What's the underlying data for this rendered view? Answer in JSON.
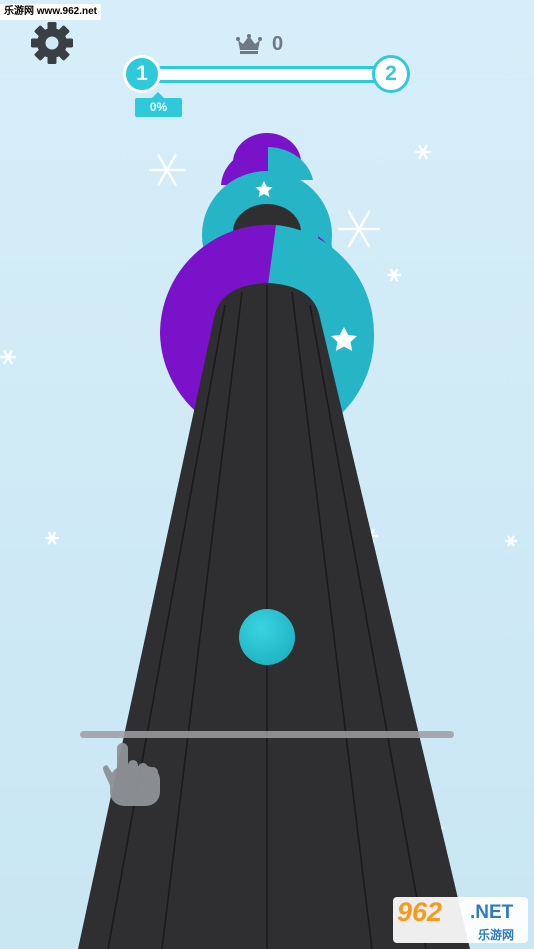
{
  "header": {
    "watermark_top": "乐游网 www.962.net",
    "score": "0",
    "level_current": "1",
    "level_next": "2",
    "progress_label": "0%",
    "progress_fraction": 0
  },
  "icons": {
    "settings": "gear-icon",
    "crown": "crown-icon",
    "hand": "swipe-hand-icon"
  },
  "colors": {
    "background": "#cfe9f6",
    "accent": "#2fc9dc",
    "purple": "#7a12c9",
    "teal": "#26b5c6",
    "track": "#2f2f31",
    "ball": "#26c3d3"
  },
  "logo": {
    "brand": "962",
    "suffix": ".NET",
    "sub": "乐游网"
  }
}
